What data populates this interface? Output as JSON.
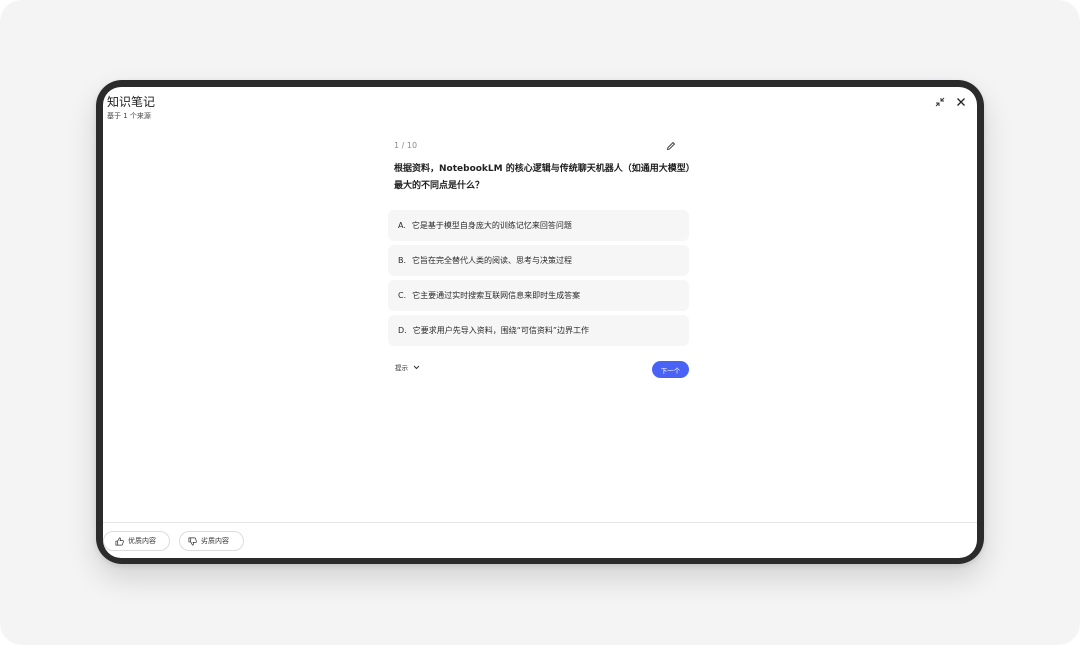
{
  "header": {
    "title": "知识笔记",
    "subtitle": "基于 1 个来源",
    "collapse_icon": "collapse-icon",
    "close_icon": "close-icon"
  },
  "quiz": {
    "progress": "1 / 10",
    "edit_icon": "pencil-icon",
    "question": "根据资料，NotebookLM 的核心逻辑与传统聊天机器人（如通用大模型）最大的不同点是什么？",
    "options": [
      {
        "letter": "A.",
        "text": "它是基于模型自身庞大的训练记忆来回答问题"
      },
      {
        "letter": "B.",
        "text": "它旨在完全替代人类的阅读、思考与决策过程"
      },
      {
        "letter": "C.",
        "text": "它主要通过实时搜索互联网信息来即时生成答案"
      },
      {
        "letter": "D.",
        "text": "它要求用户先导入资料，围绕“可信资料”边界工作"
      }
    ],
    "hint_label": "提示",
    "next_label": "下一个"
  },
  "footer": {
    "good_label": "优质内容",
    "bad_label": "劣质内容",
    "good_icon": "thumbs-up-icon",
    "bad_icon": "thumbs-down-icon"
  },
  "colors": {
    "accent": "#4a63f5",
    "device_frame": "#2b2b2c",
    "option_bg": "#f6f6f7"
  }
}
